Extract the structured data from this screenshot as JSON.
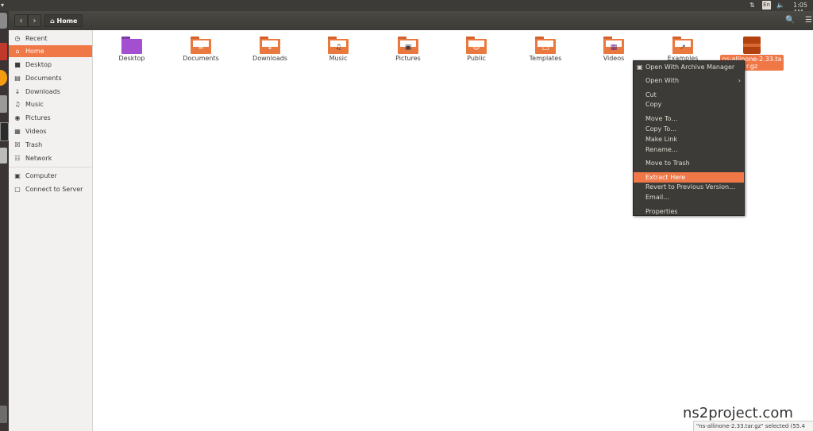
{
  "top_panel": {
    "left_glyph": "▾",
    "network_icon": "⇅",
    "language": "En",
    "volume_icon": "🔈",
    "clock": "1:05 AM"
  },
  "launcher_icons": [
    "home-folder-icon",
    "files-icon",
    "firefox-icon",
    "settings-icon",
    "terminal-icon",
    "ubuntu-software-icon",
    "trash-icon"
  ],
  "toolbar": {
    "back": "‹",
    "forward": "›",
    "home_glyph": "⌂",
    "location": "Home",
    "search_icon": "🔍",
    "view_icon": "☰"
  },
  "sidebar": {
    "items": [
      {
        "label": "Recent",
        "icon": "◷"
      },
      {
        "label": "Home",
        "icon": "⌂"
      },
      {
        "label": "Desktop",
        "icon": "■"
      },
      {
        "label": "Documents",
        "icon": "▤"
      },
      {
        "label": "Downloads",
        "icon": "↓"
      },
      {
        "label": "Music",
        "icon": "♫"
      },
      {
        "label": "Pictures",
        "icon": "◉"
      },
      {
        "label": "Videos",
        "icon": "▦"
      },
      {
        "label": "Trash",
        "icon": "☒"
      },
      {
        "label": "Network",
        "icon": "☷"
      },
      {
        "label": "Computer",
        "icon": "▣"
      },
      {
        "label": "Connect to Server",
        "icon": "▢"
      }
    ]
  },
  "files": [
    {
      "label": "Desktop",
      "emblem": ""
    },
    {
      "label": "Documents",
      "emblem": "≡"
    },
    {
      "label": "Downloads",
      "emblem": "↓"
    },
    {
      "label": "Music",
      "emblem": "♫"
    },
    {
      "label": "Pictures",
      "emblem": "▣"
    },
    {
      "label": "Public",
      "emblem": "☺"
    },
    {
      "label": "Templates",
      "emblem": "□"
    },
    {
      "label": "Videos",
      "emblem": "▦"
    },
    {
      "label": "Examples",
      "emblem": "↗"
    },
    {
      "label": "ns-allinone-2.33.tar.gz",
      "emblem": ""
    }
  ],
  "context_menu": {
    "items": [
      {
        "label": "Open With Archive Manager",
        "icon": "▣"
      },
      {
        "label": "Open With",
        "submenu": "›"
      },
      {
        "label": "Cut"
      },
      {
        "label": "Copy"
      },
      {
        "label": "Move To…"
      },
      {
        "label": "Copy To…"
      },
      {
        "label": "Make Link"
      },
      {
        "label": "Rename…"
      },
      {
        "label": "Move to Trash"
      },
      {
        "label": "Extract Here"
      },
      {
        "label": "Revert to Previous Version…"
      },
      {
        "label": "Email…"
      },
      {
        "label": "Properties"
      }
    ],
    "highlighted": "Extract Here"
  },
  "status_bar": "\"ns-allinone-2.33.tar.gz\" selected (55.4",
  "watermark": "ns2project.com",
  "colors": {
    "accent": "#f07746",
    "panel": "#3c3b37",
    "folder": "#e9793f"
  }
}
